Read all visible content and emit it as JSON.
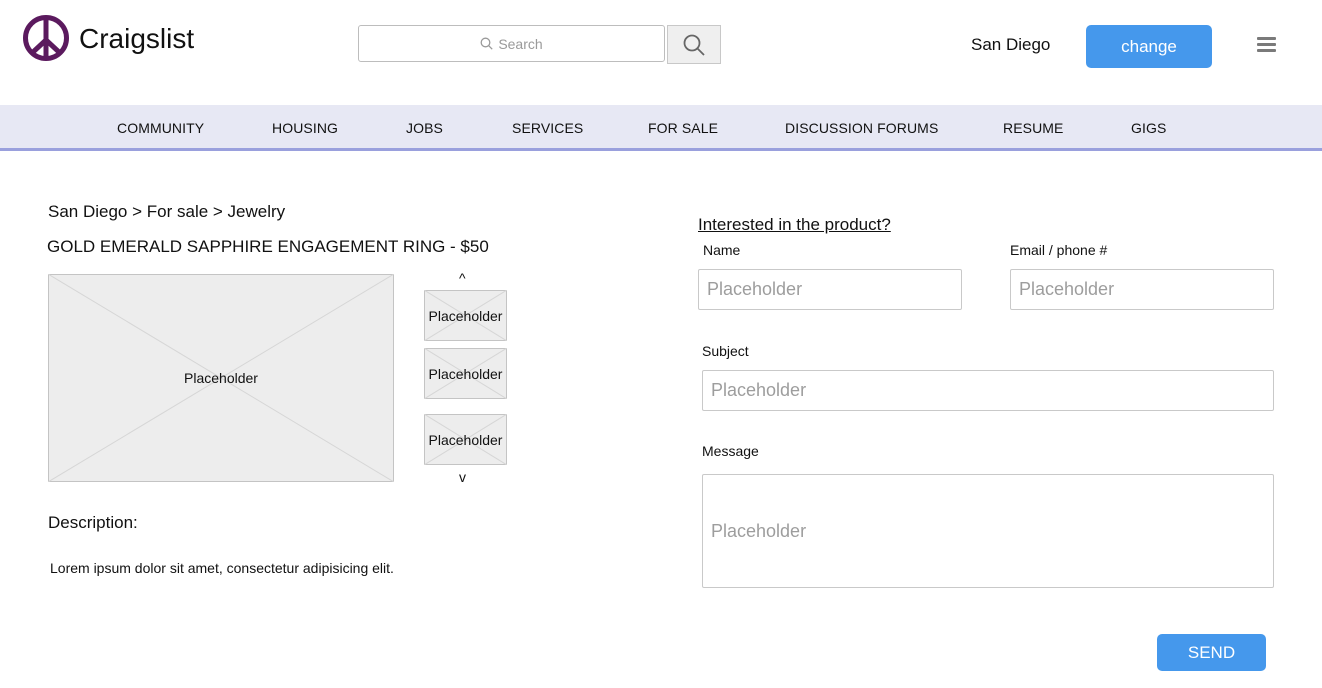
{
  "header": {
    "brand": "Craigslist",
    "search_placeholder": "Search",
    "city": "San Diego",
    "change_label": "change"
  },
  "nav": {
    "items": [
      "COMMUNITY",
      "HOUSING",
      "JOBS",
      "SERVICES",
      "FOR SALE",
      "DISCUSSION FORUMS",
      "RESUME",
      "GIGS"
    ]
  },
  "listing": {
    "breadcrumb": "San Diego > For sale > Jewelry",
    "title": "GOLD EMERALD SAPPHIRE ENGAGEMENT RING - $50",
    "main_image_label": "Placeholder",
    "thumbnails": [
      "Placeholder",
      "Placeholder",
      "Placeholder"
    ],
    "scroll_up": "^",
    "scroll_down": "v",
    "description_label": "Description:",
    "description_text": "Lorem ipsum dolor sit amet, consectetur adipisicing elit."
  },
  "form": {
    "heading": "Interested in the product?",
    "name_label": "Name",
    "name_placeholder": "Placeholder",
    "email_label": "Email / phone #",
    "email_placeholder": "Placeholder",
    "subject_label": "Subject",
    "subject_placeholder": "Placeholder",
    "message_label": "Message",
    "message_placeholder": "Placeholder",
    "send_label": "SEND"
  },
  "colors": {
    "accent": "#4598ec",
    "nav_bg": "#e7e8f4",
    "nav_line": "#9aa0dd",
    "logo": "#5b1a5e"
  }
}
